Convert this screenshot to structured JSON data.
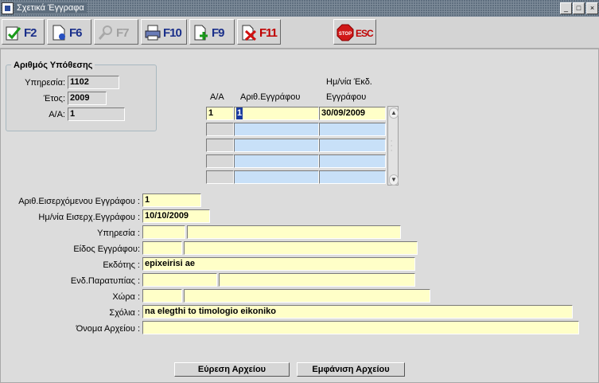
{
  "window": {
    "title": "Σχετικά Έγγραφα",
    "minimize": "_",
    "maximize": "□",
    "close": "×"
  },
  "toolbar": {
    "f2": "F2",
    "f6": "F6",
    "f7": "F7",
    "f10": "F10",
    "f9": "F9",
    "f11": "F11",
    "esc": "ESC",
    "stop": "STOP"
  },
  "case": {
    "group_title": "Αριθμός Υπόθεσης",
    "service_label": "Υπηρεσία:",
    "service": "1102",
    "year_label": "Έτος:",
    "year": "2009",
    "aa_label": "Α/Α:",
    "aa": "1"
  },
  "docs_table": {
    "col_aa": "Α/Α",
    "col_docno": "Αριθ.Εγγράφου",
    "col_date_l1": "Ημ/νία Έκδ.",
    "col_date_l2": "Εγγράφου",
    "rows": [
      {
        "aa": "1",
        "docno": "1",
        "date": "30/09/2009"
      },
      {
        "aa": "",
        "docno": "",
        "date": ""
      },
      {
        "aa": "",
        "docno": "",
        "date": ""
      },
      {
        "aa": "",
        "docno": "",
        "date": ""
      },
      {
        "aa": "",
        "docno": "",
        "date": ""
      }
    ]
  },
  "form": {
    "incoming_no_label": "Αριθ.Εισερχόμενου Εγγράφου :",
    "incoming_no": "1",
    "incoming_date_label": "Ημ/νία Εισερχ.Εγγράφου :",
    "incoming_date": "10/10/2009",
    "service_label": "Υπηρεσία :",
    "service_code": "",
    "service_name": "",
    "doctype_label": "Είδος Εγγράφου:",
    "doctype_code": "",
    "doctype_name": "",
    "issuer_label": "Εκδότης :",
    "issuer": "epixeirisi ae",
    "discrepancy_label": "Ενδ.Παρατυπίας :",
    "discrepancy_code": "",
    "discrepancy_name": "",
    "country_label": "Χώρα :",
    "country_code": "",
    "country_name": "",
    "comments_label": "Σχόλια :",
    "comments": "na elegthi to timologio eikoniko",
    "filename_label": "Όνομα Αρχείου :",
    "filename": ""
  },
  "buttons": {
    "find_file": "Εύρεση Αρχείου",
    "show_file": "Εμφάνιση Αρχείου"
  }
}
